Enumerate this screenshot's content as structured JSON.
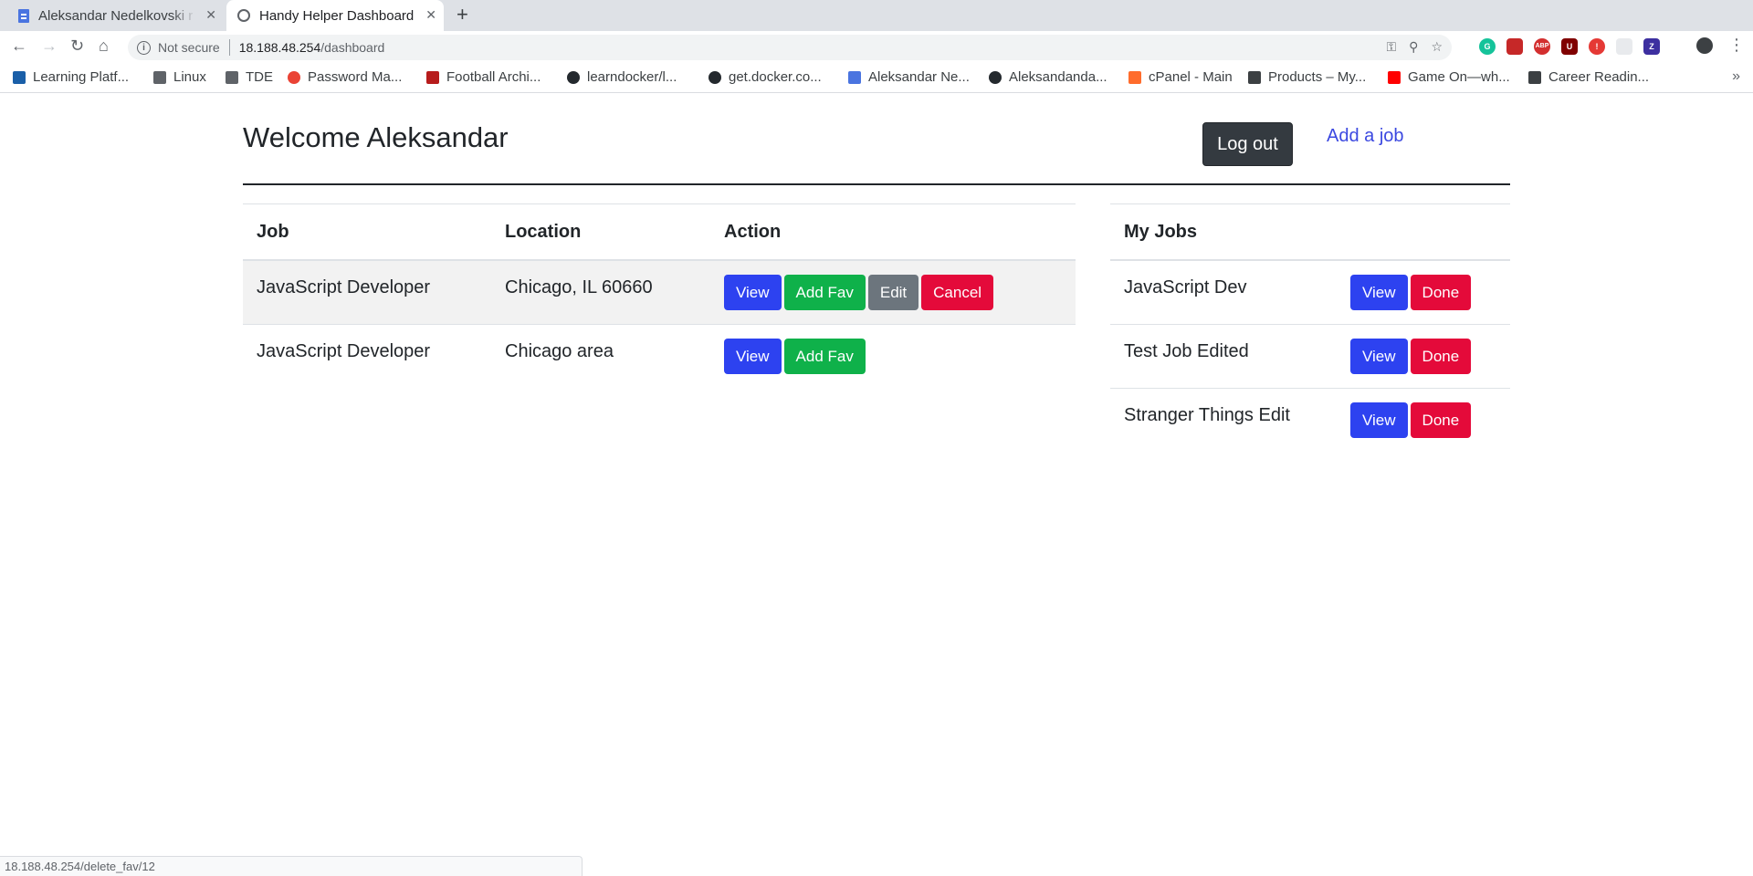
{
  "browser": {
    "tabs": [
      {
        "title": "Aleksandar Nedelkovski r",
        "icon": "doc-icon",
        "active": false
      },
      {
        "title": "Handy Helper Dashboard",
        "icon": "globe-icon",
        "active": true
      }
    ],
    "address": {
      "security": "Not secure",
      "host": "18.188.48.254",
      "path": "/dashboard"
    },
    "bookmarks": [
      "Learning Platf...",
      "Linux",
      "TDE",
      "Password Ma...",
      "Football Archi...",
      "learndocker/l...",
      "get.docker.co...",
      "Aleksandar Ne...",
      "Aleksandanda...",
      "cPanel - Main",
      "Products – My...",
      "Game On—wh...",
      "Career Readin..."
    ],
    "status_url": "18.188.48.254/delete_fav/12"
  },
  "header": {
    "welcome": "Welcome Aleksandar",
    "logout_label": "Log out",
    "add_job_label": "Add a job"
  },
  "jobs_table": {
    "headers": [
      "Job",
      "Location",
      "Action"
    ],
    "rows": [
      {
        "job": "JavaScript Developer",
        "location": "Chicago, IL 60660",
        "actions": [
          "View",
          "Add Fav",
          "Edit",
          "Cancel"
        ]
      },
      {
        "job": "JavaScript Developer",
        "location": "Chicago area",
        "actions": [
          "View",
          "Add Fav"
        ]
      }
    ]
  },
  "my_jobs": {
    "header": "My Jobs",
    "rows": [
      {
        "name": "JavaScript Dev",
        "actions": [
          "View",
          "Done"
        ]
      },
      {
        "name": "Test Job Edited",
        "actions": [
          "View",
          "Done"
        ]
      },
      {
        "name": "Stranger Things Edit",
        "actions": [
          "View",
          "Done"
        ]
      }
    ]
  },
  "colors": {
    "primary": "#2d42f0",
    "success": "#0fb14a",
    "secondary": "#6c757d",
    "danger": "#e40a3a",
    "dark": "#343a40",
    "link": "#3b48e0"
  }
}
